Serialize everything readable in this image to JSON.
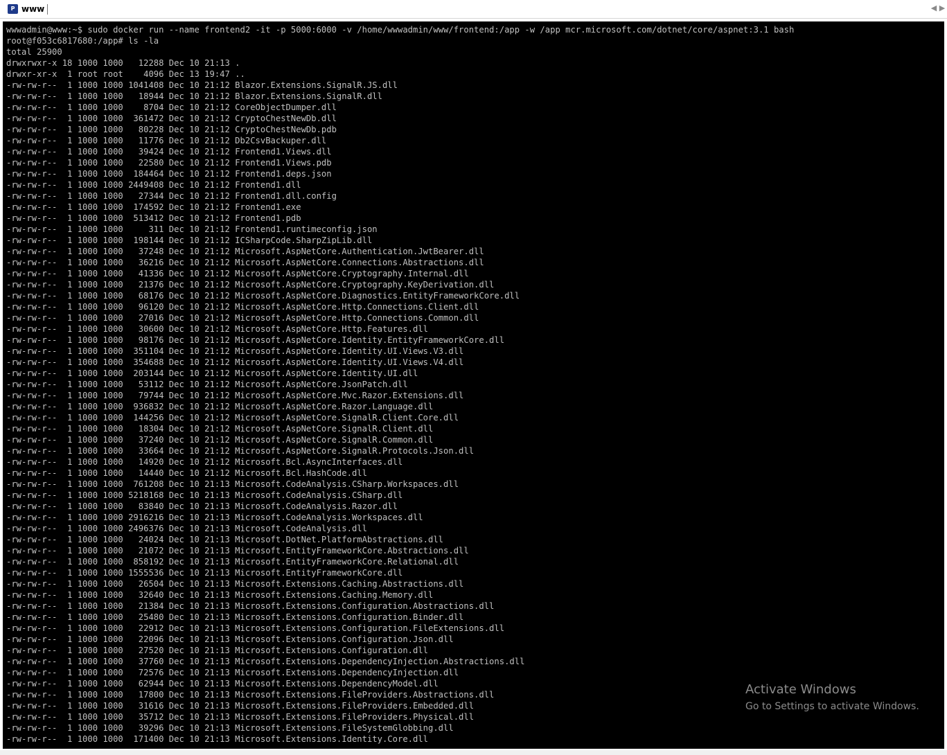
{
  "window": {
    "title": "www",
    "icon_text": "P",
    "nav_prev": "◀",
    "nav_next": "▶"
  },
  "terminal": {
    "lines": [
      "wwwadmin@www:~$ sudo docker run --name frontend2 -it -p 5000:6000 -v /home/wwwadmin/www/frontend:/app -w /app mcr.microsoft.com/dotnet/core/aspnet:3.1 bash",
      "root@f053c6817680:/app# ls -la",
      "total 25900",
      "drwxrwxr-x 18 1000 1000   12288 Dec 10 21:13 .",
      "drwxr-xr-x  1 root root    4096 Dec 13 19:47 ..",
      "-rw-rw-r--  1 1000 1000 1041408 Dec 10 21:12 Blazor.Extensions.SignalR.JS.dll",
      "-rw-rw-r--  1 1000 1000   18944 Dec 10 21:12 Blazor.Extensions.SignalR.dll",
      "-rw-rw-r--  1 1000 1000    8704 Dec 10 21:12 CoreObjectDumper.dll",
      "-rw-rw-r--  1 1000 1000  361472 Dec 10 21:12 CryptoChestNewDb.dll",
      "-rw-rw-r--  1 1000 1000   80228 Dec 10 21:12 CryptoChestNewDb.pdb",
      "-rw-rw-r--  1 1000 1000   11776 Dec 10 21:12 Db2CsvBackuper.dll",
      "-rw-rw-r--  1 1000 1000   39424 Dec 10 21:12 Frontend1.Views.dll",
      "-rw-rw-r--  1 1000 1000   22580 Dec 10 21:12 Frontend1.Views.pdb",
      "-rw-rw-r--  1 1000 1000  184464 Dec 10 21:12 Frontend1.deps.json",
      "-rw-rw-r--  1 1000 1000 2449408 Dec 10 21:12 Frontend1.dll",
      "-rw-rw-r--  1 1000 1000   27344 Dec 10 21:12 Frontend1.dll.config",
      "-rw-rw-r--  1 1000 1000  174592 Dec 10 21:12 Frontend1.exe",
      "-rw-rw-r--  1 1000 1000  513412 Dec 10 21:12 Frontend1.pdb",
      "-rw-rw-r--  1 1000 1000     311 Dec 10 21:12 Frontend1.runtimeconfig.json",
      "-rw-rw-r--  1 1000 1000  198144 Dec 10 21:12 ICSharpCode.SharpZipLib.dll",
      "-rw-rw-r--  1 1000 1000   37248 Dec 10 21:12 Microsoft.AspNetCore.Authentication.JwtBearer.dll",
      "-rw-rw-r--  1 1000 1000   36216 Dec 10 21:12 Microsoft.AspNetCore.Connections.Abstractions.dll",
      "-rw-rw-r--  1 1000 1000   41336 Dec 10 21:12 Microsoft.AspNetCore.Cryptography.Internal.dll",
      "-rw-rw-r--  1 1000 1000   21376 Dec 10 21:12 Microsoft.AspNetCore.Cryptography.KeyDerivation.dll",
      "-rw-rw-r--  1 1000 1000   68176 Dec 10 21:12 Microsoft.AspNetCore.Diagnostics.EntityFrameworkCore.dll",
      "-rw-rw-r--  1 1000 1000   96120 Dec 10 21:12 Microsoft.AspNetCore.Http.Connections.Client.dll",
      "-rw-rw-r--  1 1000 1000   27016 Dec 10 21:12 Microsoft.AspNetCore.Http.Connections.Common.dll",
      "-rw-rw-r--  1 1000 1000   30600 Dec 10 21:12 Microsoft.AspNetCore.Http.Features.dll",
      "-rw-rw-r--  1 1000 1000   98176 Dec 10 21:12 Microsoft.AspNetCore.Identity.EntityFrameworkCore.dll",
      "-rw-rw-r--  1 1000 1000  351104 Dec 10 21:12 Microsoft.AspNetCore.Identity.UI.Views.V3.dll",
      "-rw-rw-r--  1 1000 1000  354688 Dec 10 21:12 Microsoft.AspNetCore.Identity.UI.Views.V4.dll",
      "-rw-rw-r--  1 1000 1000  203144 Dec 10 21:12 Microsoft.AspNetCore.Identity.UI.dll",
      "-rw-rw-r--  1 1000 1000   53112 Dec 10 21:12 Microsoft.AspNetCore.JsonPatch.dll",
      "-rw-rw-r--  1 1000 1000   79744 Dec 10 21:12 Microsoft.AspNetCore.Mvc.Razor.Extensions.dll",
      "-rw-rw-r--  1 1000 1000  936832 Dec 10 21:12 Microsoft.AspNetCore.Razor.Language.dll",
      "-rw-rw-r--  1 1000 1000  144256 Dec 10 21:12 Microsoft.AspNetCore.SignalR.Client.Core.dll",
      "-rw-rw-r--  1 1000 1000   18304 Dec 10 21:12 Microsoft.AspNetCore.SignalR.Client.dll",
      "-rw-rw-r--  1 1000 1000   37240 Dec 10 21:12 Microsoft.AspNetCore.SignalR.Common.dll",
      "-rw-rw-r--  1 1000 1000   33664 Dec 10 21:12 Microsoft.AspNetCore.SignalR.Protocols.Json.dll",
      "-rw-rw-r--  1 1000 1000   14920 Dec 10 21:12 Microsoft.Bcl.AsyncInterfaces.dll",
      "-rw-rw-r--  1 1000 1000   14440 Dec 10 21:12 Microsoft.Bcl.HashCode.dll",
      "-rw-rw-r--  1 1000 1000  761208 Dec 10 21:13 Microsoft.CodeAnalysis.CSharp.Workspaces.dll",
      "-rw-rw-r--  1 1000 1000 5218168 Dec 10 21:13 Microsoft.CodeAnalysis.CSharp.dll",
      "-rw-rw-r--  1 1000 1000   83840 Dec 10 21:13 Microsoft.CodeAnalysis.Razor.dll",
      "-rw-rw-r--  1 1000 1000 2916216 Dec 10 21:13 Microsoft.CodeAnalysis.Workspaces.dll",
      "-rw-rw-r--  1 1000 1000 2496376 Dec 10 21:13 Microsoft.CodeAnalysis.dll",
      "-rw-rw-r--  1 1000 1000   24024 Dec 10 21:13 Microsoft.DotNet.PlatformAbstractions.dll",
      "-rw-rw-r--  1 1000 1000   21072 Dec 10 21:13 Microsoft.EntityFrameworkCore.Abstractions.dll",
      "-rw-rw-r--  1 1000 1000  858192 Dec 10 21:13 Microsoft.EntityFrameworkCore.Relational.dll",
      "-rw-rw-r--  1 1000 1000 1555536 Dec 10 21:13 Microsoft.EntityFrameworkCore.dll",
      "-rw-rw-r--  1 1000 1000   26504 Dec 10 21:13 Microsoft.Extensions.Caching.Abstractions.dll",
      "-rw-rw-r--  1 1000 1000   32640 Dec 10 21:13 Microsoft.Extensions.Caching.Memory.dll",
      "-rw-rw-r--  1 1000 1000   21384 Dec 10 21:13 Microsoft.Extensions.Configuration.Abstractions.dll",
      "-rw-rw-r--  1 1000 1000   25480 Dec 10 21:13 Microsoft.Extensions.Configuration.Binder.dll",
      "-rw-rw-r--  1 1000 1000   22912 Dec 10 21:13 Microsoft.Extensions.Configuration.FileExtensions.dll",
      "-rw-rw-r--  1 1000 1000   22096 Dec 10 21:13 Microsoft.Extensions.Configuration.Json.dll",
      "-rw-rw-r--  1 1000 1000   27520 Dec 10 21:13 Microsoft.Extensions.Configuration.dll",
      "-rw-rw-r--  1 1000 1000   37760 Dec 10 21:13 Microsoft.Extensions.DependencyInjection.Abstractions.dll",
      "-rw-rw-r--  1 1000 1000   72576 Dec 10 21:13 Microsoft.Extensions.DependencyInjection.dll",
      "-rw-rw-r--  1 1000 1000   62944 Dec 10 21:13 Microsoft.Extensions.DependencyModel.dll",
      "-rw-rw-r--  1 1000 1000   17800 Dec 10 21:13 Microsoft.Extensions.FileProviders.Abstractions.dll",
      "-rw-rw-r--  1 1000 1000   31616 Dec 10 21:13 Microsoft.Extensions.FileProviders.Embedded.dll",
      "-rw-rw-r--  1 1000 1000   35712 Dec 10 21:13 Microsoft.Extensions.FileProviders.Physical.dll",
      "-rw-rw-r--  1 1000 1000   39296 Dec 10 21:13 Microsoft.Extensions.FileSystemGlobbing.dll",
      "-rw-rw-r--  1 1000 1000  171400 Dec 10 21:13 Microsoft.Extensions.Identity.Core.dll"
    ]
  },
  "watermark": {
    "title": "Activate Windows",
    "subtitle": "Go to Settings to activate Windows."
  },
  "colors": {
    "terminal_bg": "#000000",
    "terminal_fg": "#c0c0c0",
    "titlebar_bg": "#ffffff",
    "watermark": "#8b8b8b"
  }
}
